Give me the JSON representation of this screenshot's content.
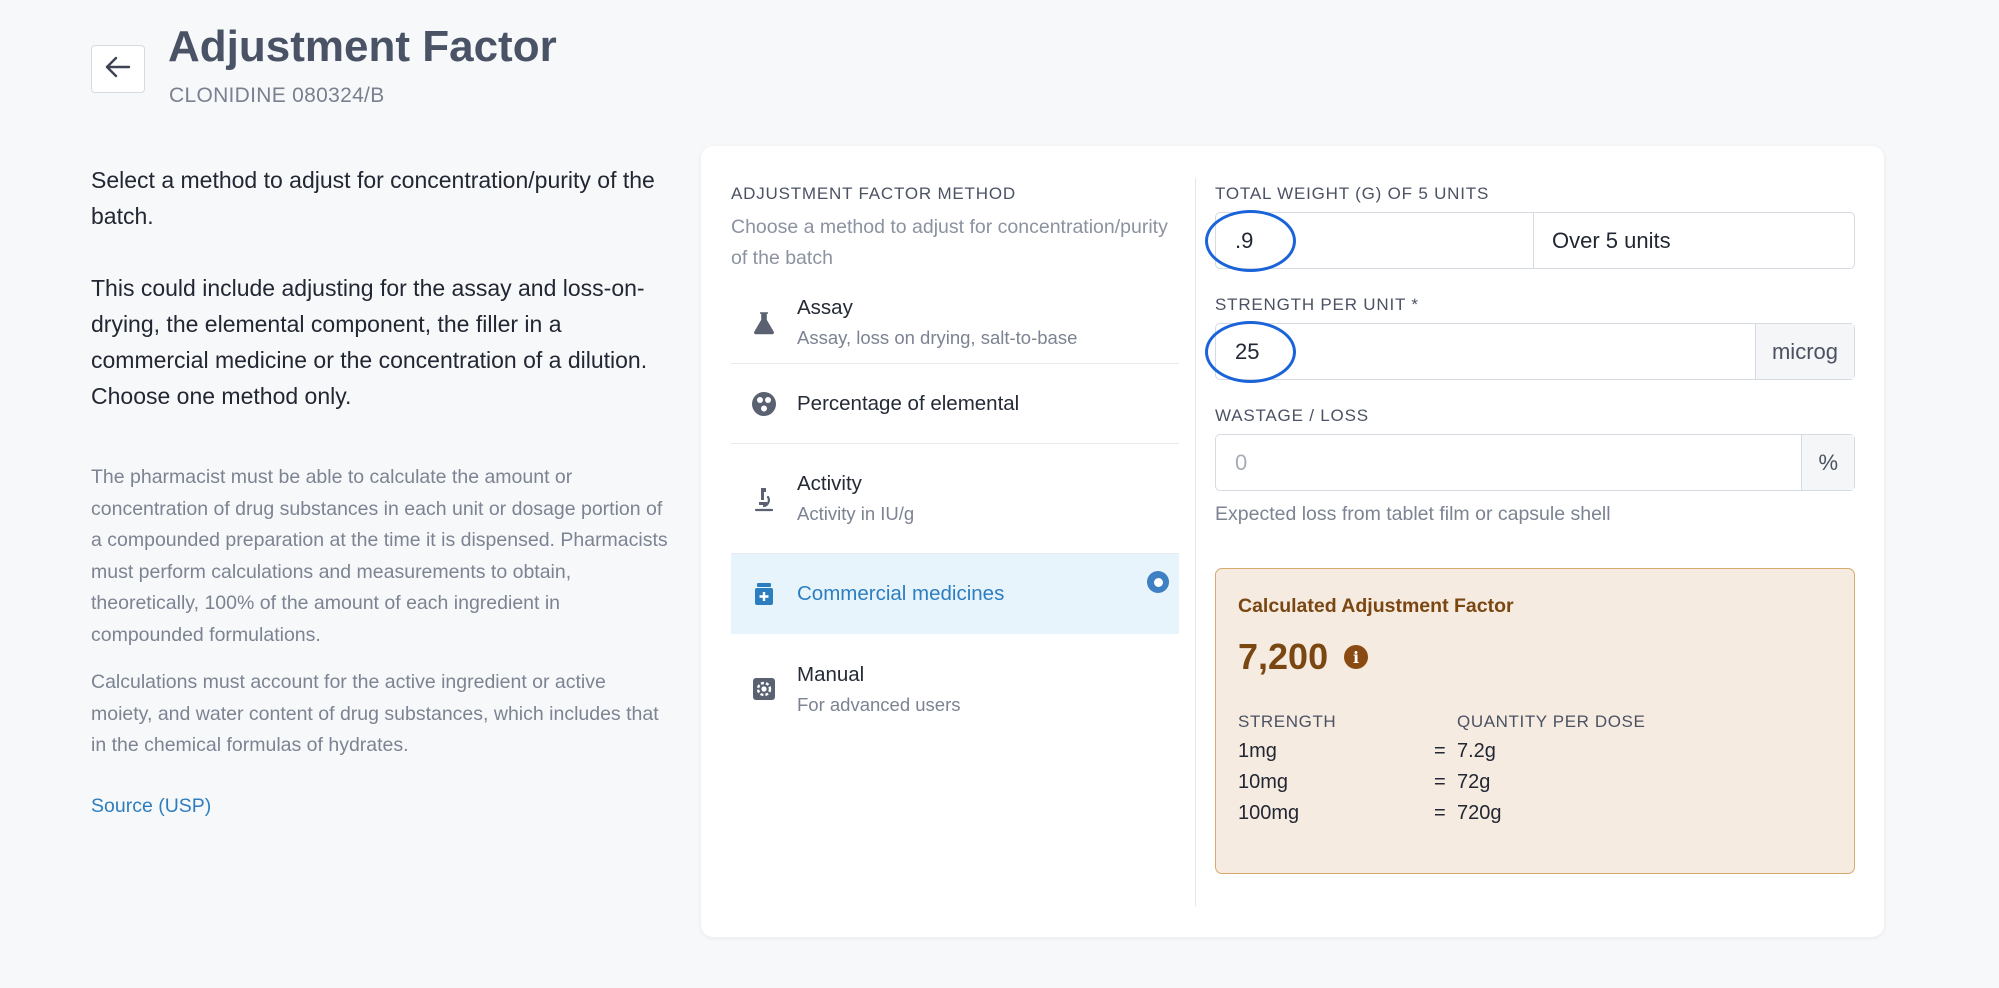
{
  "header": {
    "title": "Adjustment Factor",
    "subtitle": "CLONIDINE 080324/B"
  },
  "intro": {
    "paragraph1": "Select a method to adjust for concentration/purity of the batch.",
    "paragraph2": "This could include adjusting for the assay and loss-on-drying, the elemental component, the filler in a commercial medicine or the concentration of a dilution. Choose one method only.",
    "note1": "The pharmacist must be able to calculate the amount or concentration of drug substances in each unit or dosage portion of a compounded preparation at the time it is dispensed. Pharmacists must perform calculations and measurements to obtain, theoretically, 100% of the amount of each ingredient in compounded formulations.",
    "note2": "Calculations must account for the active ingredient or active moiety, and water content of drug substances, which includes that in the chemical formulas of hydrates.",
    "source_link": "Source (USP)"
  },
  "method": {
    "label": "ADJUSTMENT FACTOR METHOD",
    "help": "Choose a method to adjust for concentration/purity of the batch",
    "items": [
      {
        "title": "Assay",
        "desc": "Assay, loss on drying, salt-to-base",
        "icon": "flask-icon"
      },
      {
        "title": "Percentage of elemental",
        "desc": "",
        "icon": "atom-icon"
      },
      {
        "title": "Activity",
        "desc": "Activity in IU/g",
        "icon": "microscope-icon"
      },
      {
        "title": "Commercial medicines",
        "desc": "",
        "icon": "medicine-bottle-icon",
        "selected": true
      },
      {
        "title": "Manual",
        "desc": "For advanced users",
        "icon": "settings-icon"
      }
    ]
  },
  "form": {
    "total_weight": {
      "label": "TOTAL WEIGHT (G) OF 5 UNITS",
      "value": ".9",
      "suffix": "Over 5 units"
    },
    "strength": {
      "label": "STRENGTH PER UNIT *",
      "value": "25",
      "unit": "microg"
    },
    "wastage": {
      "label": "WASTAGE / LOSS",
      "placeholder": "0",
      "unit": "%",
      "help": "Expected loss from tablet film or capsule shell"
    }
  },
  "result": {
    "title": "Calculated Adjustment Factor",
    "value": "7,200",
    "col_strength": "STRENGTH",
    "col_quantity": "QUANTITY PER DOSE",
    "rows": [
      {
        "strength": "1mg",
        "eq": "=",
        "quantity": "7.2g"
      },
      {
        "strength": "10mg",
        "eq": "=",
        "quantity": "72g"
      },
      {
        "strength": "100mg",
        "eq": "=",
        "quantity": "720g"
      }
    ]
  },
  "colors": {
    "accent": "#2d7ec0",
    "selected_bg": "#e7f4fc",
    "result_bg": "#f6ebe0",
    "result_text": "#7a4712",
    "highlight_ring": "#1a63d8"
  }
}
